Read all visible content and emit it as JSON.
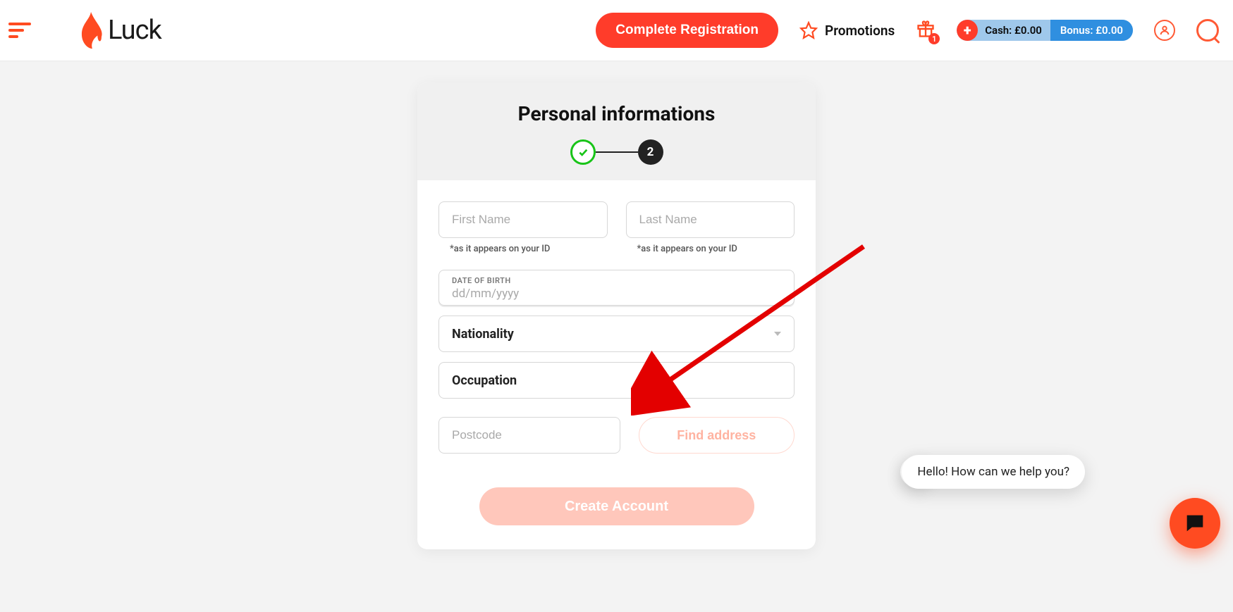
{
  "header": {
    "brand": "Luck",
    "cta": "Complete Registration",
    "promotions": "Promotions",
    "gift_badge": "1",
    "cash_label": "Cash:",
    "cash_value": "£0.00",
    "bonus_label": "Bonus:",
    "bonus_value": "£0.00"
  },
  "form": {
    "title": "Personal informations",
    "step_current": "2",
    "first_name_placeholder": "First Name",
    "last_name_placeholder": "Last Name",
    "id_hint": "*as it appears on your ID",
    "dob_label": "DATE OF BIRTH",
    "dob_placeholder": "dd/mm/yyyy",
    "nationality_label": "Nationality",
    "occupation_label": "Occupation",
    "postcode_placeholder": "Postcode",
    "find_address": "Find address",
    "create": "Create Account"
  },
  "chat": {
    "greeting": "Hello! How can we help you?"
  }
}
